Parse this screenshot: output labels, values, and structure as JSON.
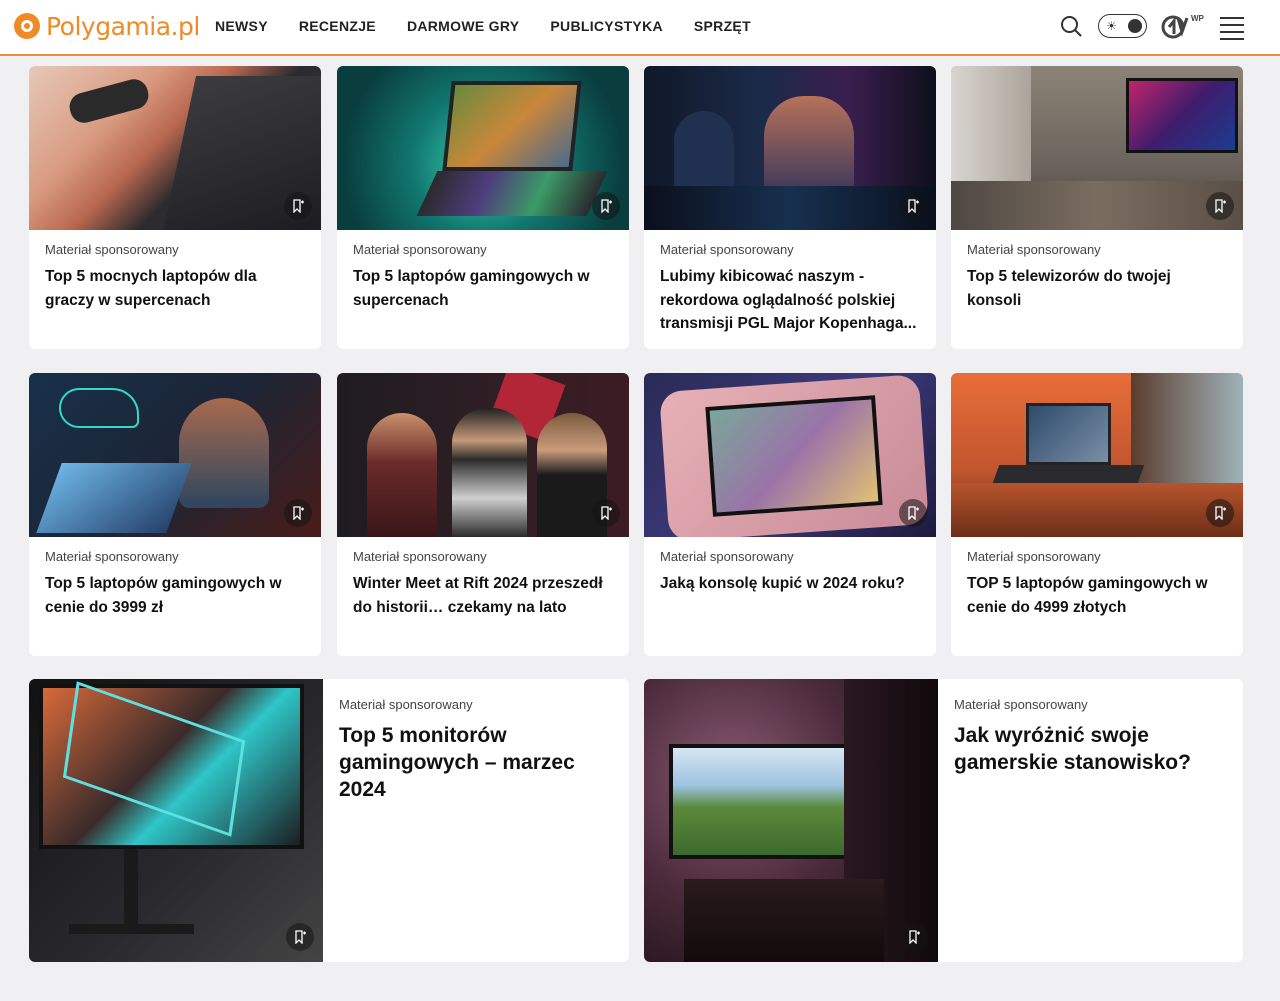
{
  "header": {
    "logo_text": "Polygamia.pl",
    "nav": [
      "NEWSY",
      "RECENZJE",
      "DARMOWE GRY",
      "PUBLICYSTYKA",
      "SPRZĘT"
    ],
    "accent": "#e8913c"
  },
  "cards": [
    {
      "meta": "Materiał sponsorowany",
      "title": "Top 5 mocnych laptopów dla graczy w supercenach"
    },
    {
      "meta": "Materiał sponsorowany",
      "title": "Top 5 laptopów gamingowych w supercenach"
    },
    {
      "meta": "Materiał sponsorowany",
      "title": "Lubimy kibicować naszym - rekordowa oglądalność polskiej transmisji PGL Major Kopenhaga..."
    },
    {
      "meta": "Materiał sponsorowany",
      "title": "Top 5 telewizorów do twojej konsoli"
    },
    {
      "meta": "Materiał sponsorowany",
      "title": "Top 5 laptopów gamingowych w cenie do 3999 zł"
    },
    {
      "meta": "Materiał sponsorowany",
      "title": "Winter Meet at Rift 2024 przeszedł do historii… czekamy na lato"
    },
    {
      "meta": "Materiał sponsorowany",
      "title": "Jaką konsolę kupić w 2024 roku?"
    },
    {
      "meta": "Materiał sponsorowany",
      "title": "TOP 5 laptopów gamingowych w cenie do 4999 złotych"
    },
    {
      "meta": "Materiał sponsorowany",
      "title": "Top 5 monitorów gamingowych – marzec 2024"
    },
    {
      "meta": "Materiał sponsorowany",
      "title": "Jak wyróżnić swoje gamerskie stanowisko?"
    }
  ]
}
